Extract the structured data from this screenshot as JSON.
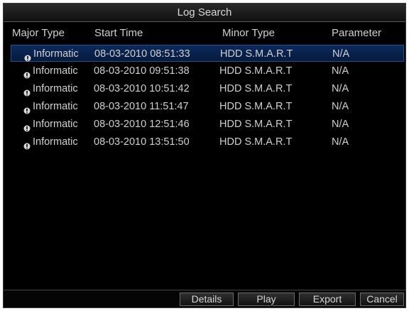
{
  "window": {
    "title": "Log Search"
  },
  "columns": {
    "major": "Major Type",
    "start": "Start Time",
    "minor": "Minor Type",
    "param": "Parameter"
  },
  "rows": [
    {
      "icon": "info-icon",
      "major": "Informatic",
      "start": "08-03-2010 08:51:33",
      "minor": "HDD S.M.A.R.T",
      "param": "N/A",
      "selected": true
    },
    {
      "icon": "info-icon",
      "major": "Informatic",
      "start": "08-03-2010 09:51:38",
      "minor": "HDD S.M.A.R.T",
      "param": "N/A",
      "selected": false
    },
    {
      "icon": "info-icon",
      "major": "Informatic",
      "start": "08-03-2010 10:51:42",
      "minor": "HDD S.M.A.R.T",
      "param": "N/A",
      "selected": false
    },
    {
      "icon": "info-icon",
      "major": "Informatic",
      "start": "08-03-2010 11:51:47",
      "minor": "HDD S.M.A.R.T",
      "param": "N/A",
      "selected": false
    },
    {
      "icon": "info-icon",
      "major": "Informatic",
      "start": "08-03-2010 12:51:46",
      "minor": "HDD S.M.A.R.T",
      "param": "N/A",
      "selected": false
    },
    {
      "icon": "info-icon",
      "major": "Informatic",
      "start": "08-03-2010 13:51:50",
      "minor": "HDD S.M.A.R.T",
      "param": "N/A",
      "selected": false
    }
  ],
  "buttons": {
    "details": "Details",
    "play": "Play",
    "export": "Export",
    "cancel": "Cancel"
  },
  "colors": {
    "background": "#000000",
    "selection": "#0b2a5c",
    "text": "#d0d0d0"
  }
}
